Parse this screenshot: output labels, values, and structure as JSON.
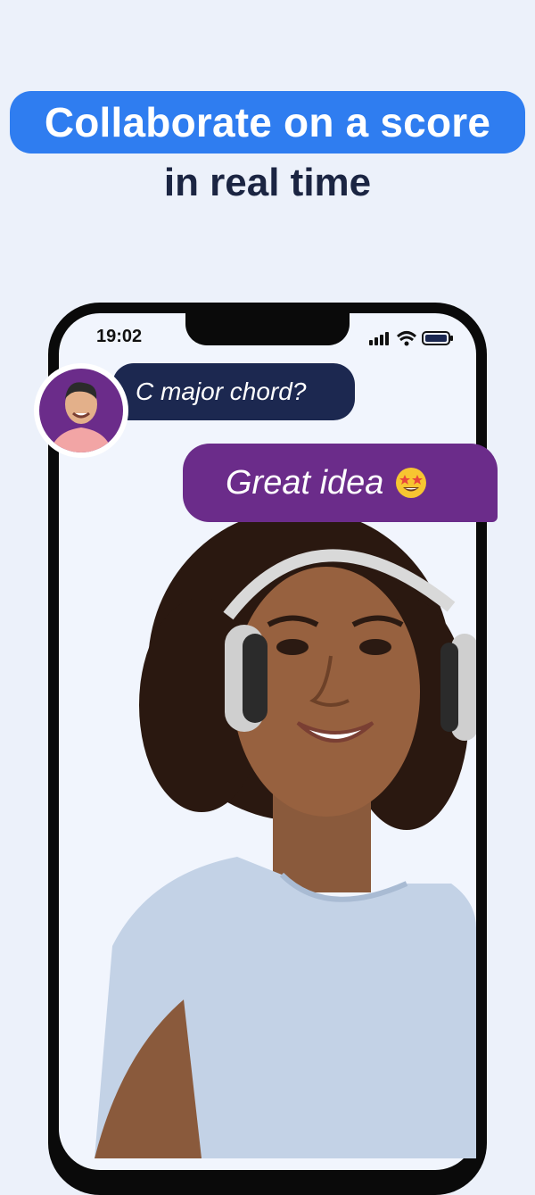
{
  "headline": {
    "line1": "Collaborate on a score",
    "line2": "in real time"
  },
  "status_bar": {
    "time": "19:02",
    "icons": [
      "signal-icon",
      "wifi-icon",
      "battery-icon"
    ]
  },
  "chat": {
    "incoming_message": "C major chord?",
    "outgoing_message": "Great idea",
    "outgoing_emoji": "star-struck-emoji"
  },
  "colors": {
    "background": "#ecf1fa",
    "headline_pill": "#2f7df0",
    "headline_text": "#1b2542",
    "incoming_bubble": "#1c2850",
    "outgoing_bubble": "#6b2c8a",
    "phone_frame": "#0a0a0a"
  }
}
